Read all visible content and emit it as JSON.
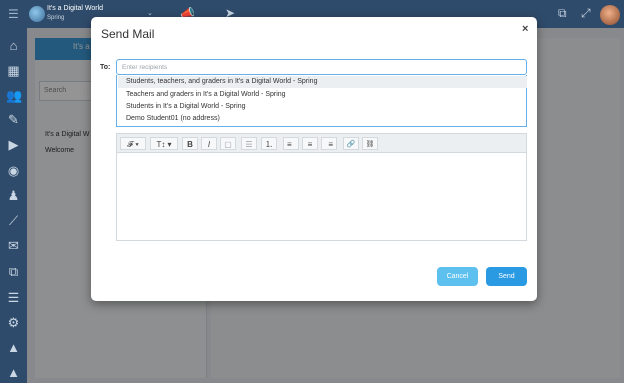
{
  "topbar": {
    "class_title": "It's a Digital World",
    "class_subtitle": "Spring"
  },
  "icons": {
    "menu": "☰",
    "caret": "⌄",
    "announce": "📣",
    "send": "➤",
    "copy": "⧉",
    "expand": "⤢"
  },
  "sidebar": {
    "items": [
      {
        "name": "home-icon",
        "glyph": "⌂"
      },
      {
        "name": "calendar-icon",
        "glyph": "▦"
      },
      {
        "name": "users-icon",
        "glyph": "👥"
      },
      {
        "name": "edit-icon",
        "glyph": "✎"
      },
      {
        "name": "play-icon",
        "glyph": "▶"
      },
      {
        "name": "palette-icon",
        "glyph": "◉"
      },
      {
        "name": "person-icon",
        "glyph": "♟"
      },
      {
        "name": "chart-icon",
        "glyph": "⟋"
      },
      {
        "name": "mail-icon",
        "glyph": "✉"
      },
      {
        "name": "documents-icon",
        "glyph": "⧉"
      },
      {
        "name": "list-icon",
        "glyph": "☰"
      },
      {
        "name": "settings-icon",
        "glyph": "⚙"
      },
      {
        "name": "warning-icon",
        "glyph": "▲"
      },
      {
        "name": "alert-icon",
        "glyph": "▲"
      }
    ]
  },
  "background": {
    "tab_label": "It's a",
    "search_label": "Search",
    "list_item_1": "It's a Digital W",
    "list_item_2": "Welcome"
  },
  "modal": {
    "title": "Send Mail",
    "close": "×",
    "to_label": "To:",
    "to_placeholder": "Enter recipients",
    "options": [
      "Students, teachers, and graders in It's a Digital World - Spring",
      "Teachers and graders in It's a Digital World - Spring",
      "Students in It's a Digital World - Spring",
      "Demo Student01 (no address)"
    ],
    "toolbar": {
      "font": "𝓕 ▾",
      "size": "T↕ ▾",
      "bold": "B",
      "italic": "I",
      "underline": "▢",
      "bullet_list": "☰",
      "number_list": "⒈",
      "align_left": "≡",
      "align_center": "≡",
      "align_right": "≡",
      "link": "🔗",
      "unlink": "⛓"
    },
    "cancel_label": "Cancel",
    "send_label": "Send"
  }
}
